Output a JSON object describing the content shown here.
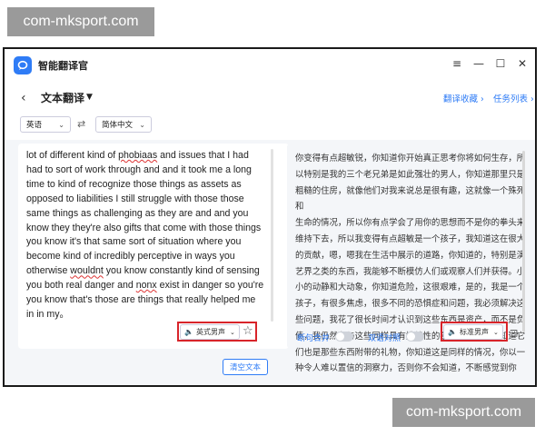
{
  "watermarks": {
    "top": "com-mksport.com",
    "bottom": "com-mksport.com"
  },
  "app": {
    "title": "智能翻译官"
  },
  "window_controls": {
    "menu": "≡",
    "minimize": "—",
    "maximize": "☐",
    "close": "✕"
  },
  "subheader": {
    "back": "‹",
    "mode": "文本翻译",
    "caret": "▼",
    "links": [
      "翻译收藏 ›",
      "任务列表 ›"
    ]
  },
  "languages": {
    "source": "英语",
    "target": "简体中文",
    "swap": "⇄",
    "caret": "⌄"
  },
  "source_text": {
    "lines": [
      [
        "lot of different kind of ",
        {
          "u": "phobiaas"
        },
        " and issues that I had"
      ],
      [
        "had to sort of work through and and it took me a long"
      ],
      [
        "time to kind of recognize those things as assets as"
      ],
      [
        "opposed to liabilities I still struggle with those those"
      ],
      [
        "same things as challenging as they are and and you"
      ],
      [
        "know they they're also gifts that come with those things"
      ],
      [
        "you know it's that same sort of situation where you"
      ],
      [
        "become kind of incredibly perceptive in ways you"
      ],
      [
        "otherwise ",
        {
          "u": "wouldnt"
        },
        " you know constantly kind of sensing"
      ],
      [
        "you both real danger and ",
        {
          "u": "nonx"
        },
        " exist in danger so you're"
      ],
      [
        "you know that's those are things that really helped me"
      ],
      [
        "in in my。"
      ]
    ]
  },
  "target_text": {
    "lines": [
      "你变得有点超敏锐，你知道你开始真正思考你将如何生存，所",
      "以特别是我的三个老兄弟是如此强壮的男人，你知道那里只是",
      "粗糙的住房，就像他们对我来说总是很有趣，这就像一个殊死和",
      "生命的情况，所以你有点学会了用你的思想而不是你的拳头来",
      "维持下去，所以我变得有点超敏是一个孩子，我知道这在很大",
      "的贡献，嗯，嗯我在生活中展示的道路，你知道的，特别是演",
      "艺界之类的东西，我能够不断模仿人们或观察人们并获得。小",
      "小的动静和大动象，你知道危险，这很艰难，是的，我是一个",
      "孩子，有很多焦虑，很多不同的恐惧症和问题，我必须解决这",
      "些问题，我花了很长时间才认识到这些东西是资产，而不是负",
      "债，我仍然在与这些同样具有挑战性的事情作斗争，你知道它",
      "们也是那些东西附带的礼物，你知道这是同样的情况，你以一",
      "种令人难以置信的洞察力，否则你不会知道，不断感觉到你"
    ]
  },
  "source_voice": {
    "icon": "speaker-icon",
    "label": "英式男声"
  },
  "target_voice": {
    "icon": "speaker-icon",
    "label": "标准男声"
  },
  "toggles": [
    {
      "label": "断句合并",
      "on": false
    },
    {
      "label": "双语对照",
      "on": false
    }
  ],
  "clear_button": "清空文本",
  "colors": {
    "accent": "#2f7cf6",
    "highlight_box": "#d8242a",
    "watermark_bg": "#9a9a9a"
  }
}
